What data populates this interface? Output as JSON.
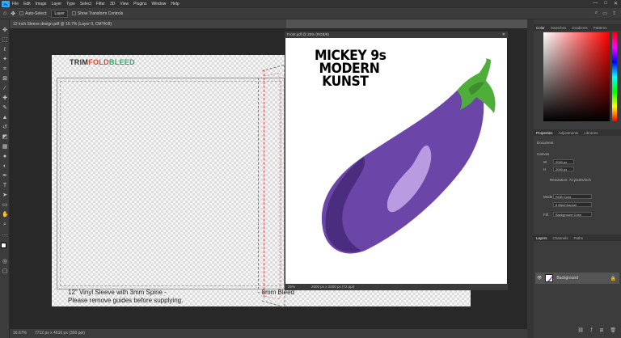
{
  "app": {
    "logo": "Ps"
  },
  "menu": [
    "File",
    "Edit",
    "Image",
    "Layer",
    "Type",
    "Select",
    "Filter",
    "3D",
    "View",
    "Plugins",
    "Window",
    "Help"
  ],
  "window_controls": {
    "minimize": "—",
    "maximize": "□",
    "close": "✕"
  },
  "options_bar": {
    "auto_select_label": "Auto-Select:",
    "auto_select_value": "Layer",
    "show_transform": "Show Transform Controls"
  },
  "doc_tab": "12 inch Sleeve design.pdf @ 16.7% (Layer 0, CMYK/8)",
  "document": {
    "logo": {
      "trim": "TRIM",
      "fold": "FOLD",
      "bleed": "BLEED"
    },
    "caption_line1_left": "12\" Vinyl Sleeve with 3mm Spine -",
    "caption_line1_right": "- 8mm Bleed",
    "caption_line2": "Please remove guides before supplying."
  },
  "floating_window": {
    "title": "Front.pdf @ 25% (RGB/8)",
    "zoom": "25%",
    "size_info": "2000 px x 2000 px (72 ppi)",
    "artwork_lines": [
      "MICKEY 9s",
      "MODERN",
      "KUNST"
    ]
  },
  "status_bar": {
    "zoom": "16.67%",
    "doc_size": "7712 px x 4616 px (300 ppi)"
  },
  "right_panel": {
    "top_tabs": [
      "Color",
      "Swatches",
      "Gradients",
      "Patterns"
    ],
    "props_tabs": [
      "Properties",
      "Adjustments",
      "Libraries"
    ],
    "doc_label": "Document",
    "canvas_label": "Canvas",
    "w_value": "2000 px",
    "h_value": "2000 px",
    "resolution": "Resolution: 72 pixels/inch",
    "mode_label": "Mode",
    "mode_value": "RGB Color",
    "bits_value": "8 Bits/Channel",
    "fill_label": "Fill",
    "fill_value": "Background Color",
    "layer_tabs": [
      "Layers",
      "Channels",
      "Paths"
    ],
    "layer_name": "Background"
  },
  "colors": {
    "accent": "#31a8ff",
    "eggplant_dark": "#4a2d7e",
    "eggplant_mid": "#6b45a8",
    "eggplant_light": "#b89be0",
    "stem_green": "#4fae3a",
    "guide_red": "#e05050"
  }
}
